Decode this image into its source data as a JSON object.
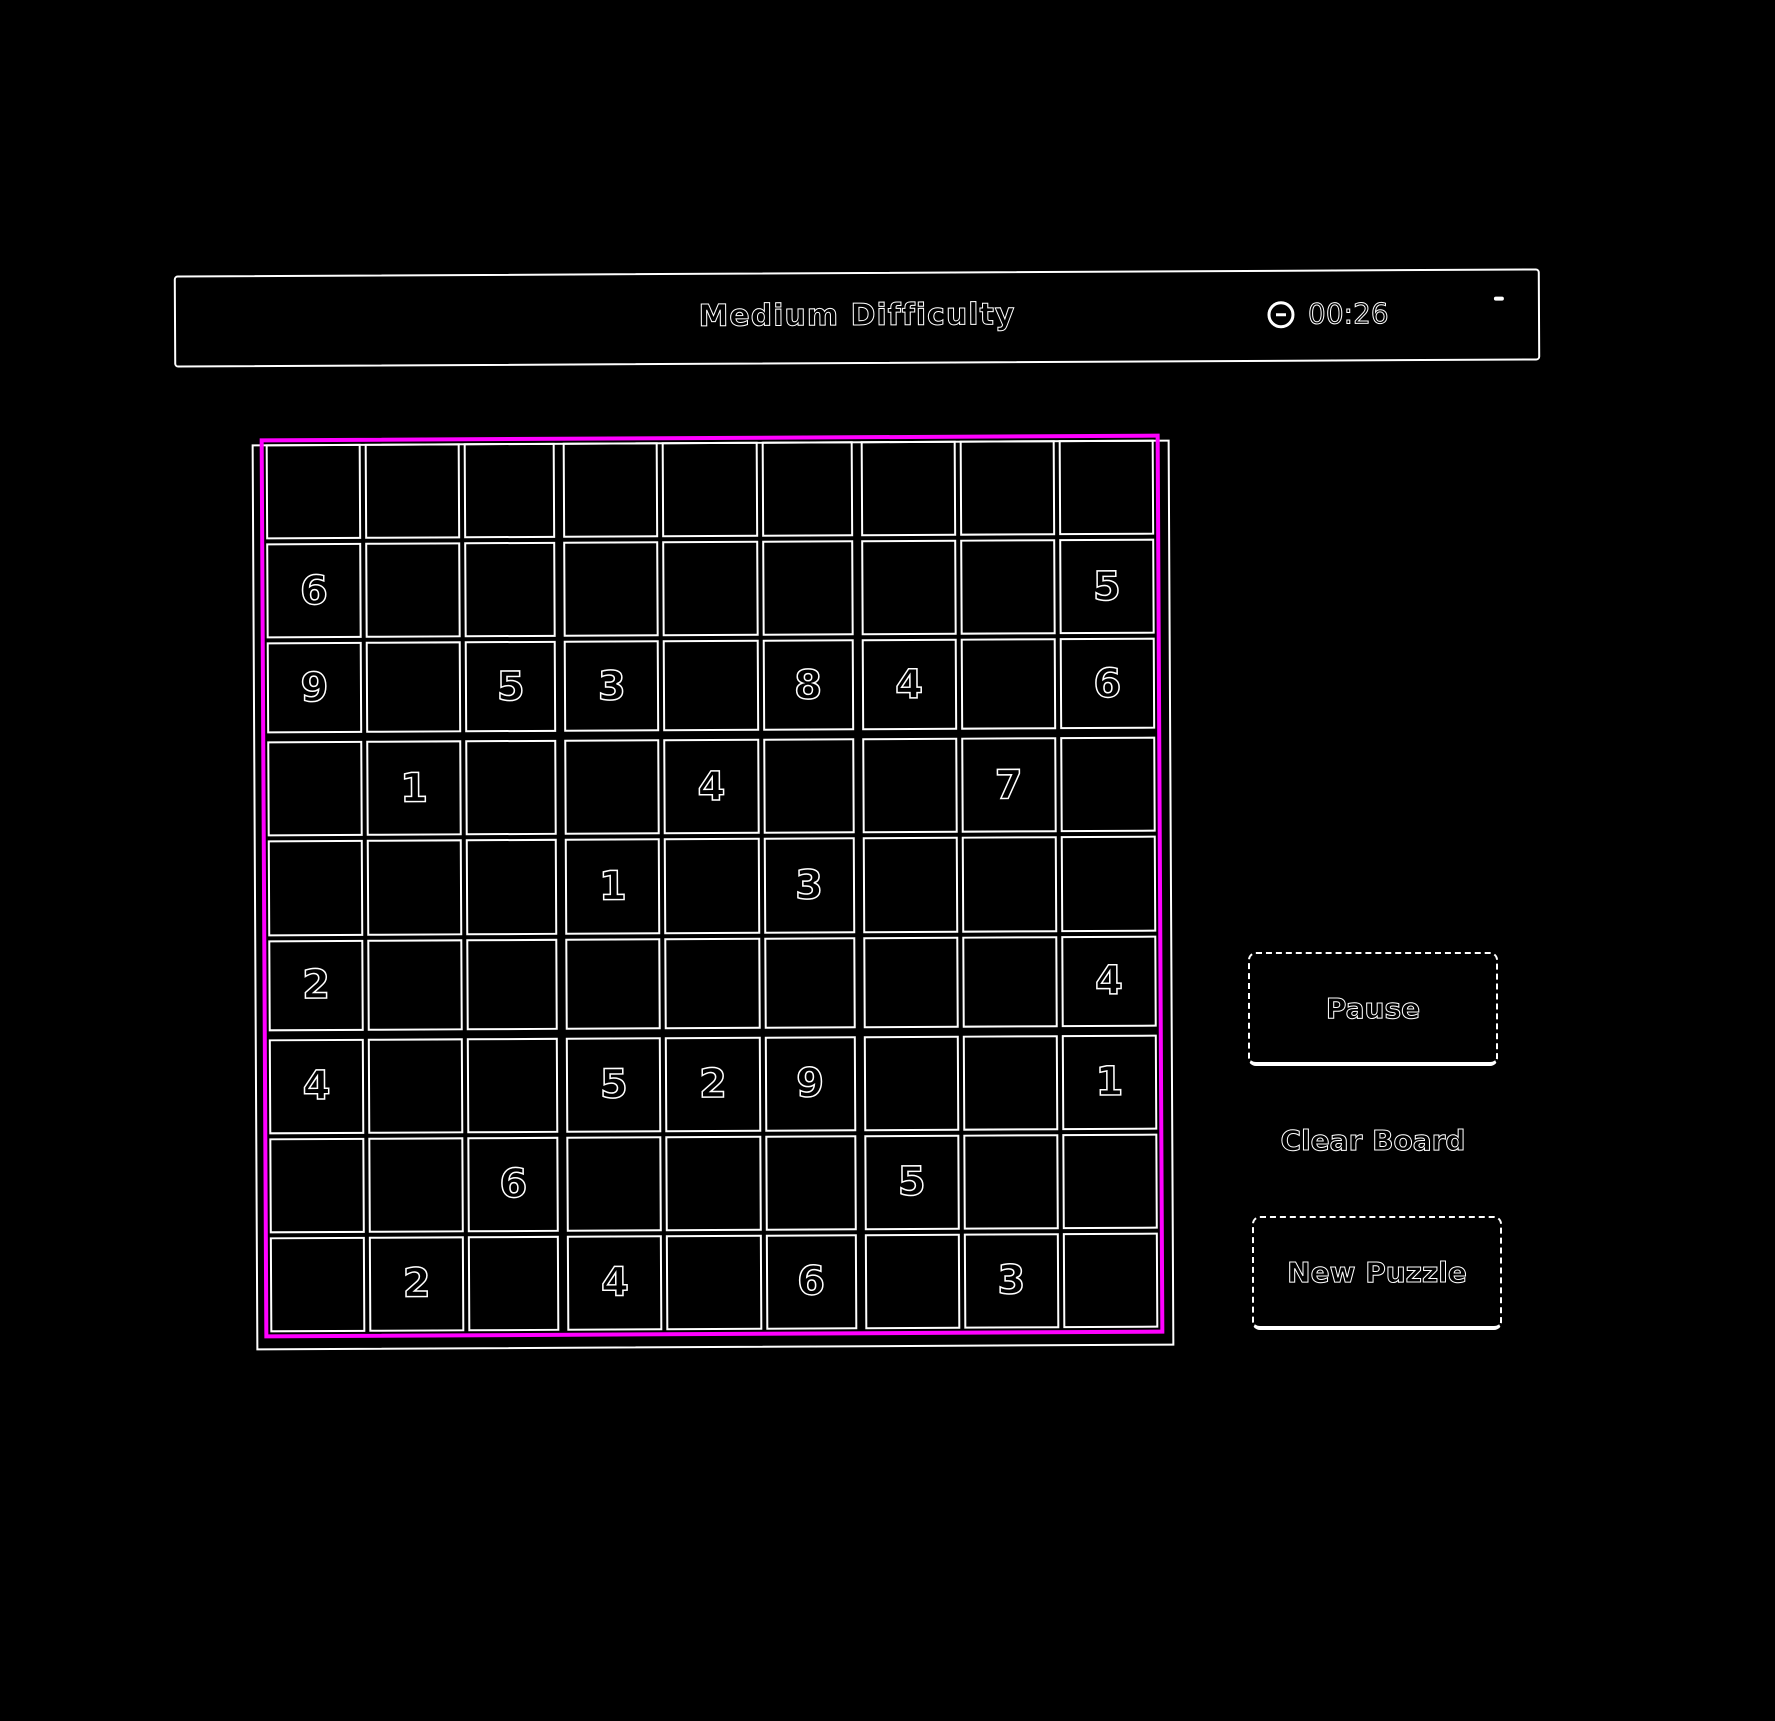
{
  "header": {
    "title": "Medium Difficulty",
    "timer": "00:26",
    "timer_icon": "clock-icon",
    "menu_icon": "menu-icon"
  },
  "board": {
    "rows": [
      [
        "",
        "",
        "",
        "",
        "",
        "",
        "",
        "",
        ""
      ],
      [
        "6",
        "",
        "",
        "",
        "",
        "",
        "",
        "",
        "5"
      ],
      [
        "9",
        "",
        "5",
        "3",
        "",
        "8",
        "4",
        "",
        "6"
      ],
      [
        "",
        "1",
        "",
        "",
        "4",
        "",
        "",
        "7",
        ""
      ],
      [
        "",
        "",
        "",
        "1",
        "",
        "3",
        "",
        "",
        ""
      ],
      [
        "2",
        "",
        "",
        "",
        "",
        "",
        "",
        "",
        "4"
      ],
      [
        "4",
        "",
        "",
        "5",
        "2",
        "9",
        "",
        "",
        "1"
      ],
      [
        "",
        "",
        "6",
        "",
        "",
        "",
        "5",
        "",
        ""
      ],
      [
        "",
        "2",
        "",
        "4",
        "",
        "6",
        "",
        "3",
        ""
      ]
    ],
    "highlight_color": "#ff00ff"
  },
  "controls": {
    "pause_label": "Pause",
    "clear_label": "Clear Board",
    "new_label": "New Puzzle"
  }
}
